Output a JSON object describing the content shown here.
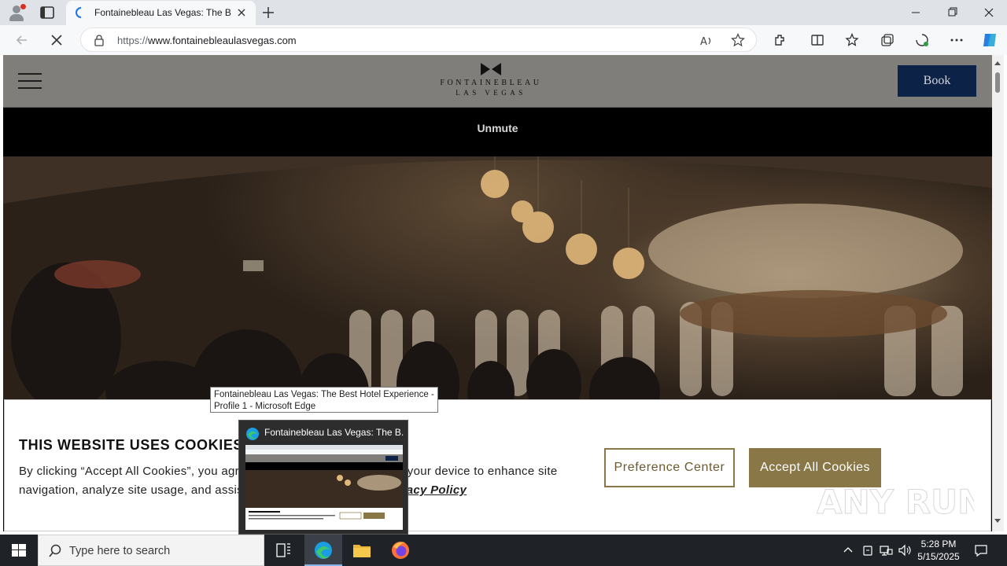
{
  "browser": {
    "tab_title": "Fontainebleau Las Vegas: The Best Hotel Experience",
    "url_prefix": "https://",
    "url_host": "www.fontainebleaulasvegas.com"
  },
  "site": {
    "logo_name": "FONTAINEBLEAU",
    "logo_city": "LAS VEGAS",
    "book_label": "Book",
    "unmute_label": "Unmute"
  },
  "cookie_banner": {
    "heading": "THIS WEBSITE USES COOKIES",
    "body_text": "By clicking “Accept All Cookies”, you agree to the storing of cookies on your device to enhance site navigation, analyze site usage, and assist in our marketing efforts.",
    "policy_link": "Privacy Policy",
    "preference_button": "Preference Center",
    "accept_button": "Accept All Cookies"
  },
  "overlays": {
    "tooltip_text": "Fontainebleau Las Vegas: The Best Hotel Experience - Profile 1 - Microsoft Edge",
    "thumbnail_title": "Fontainebleau Las Vegas: The B..."
  },
  "watermark": "ANY RUN",
  "taskbar": {
    "search_placeholder": "Type here to search",
    "time": "5:28 PM",
    "date": "5/15/2025"
  },
  "colors": {
    "book_button": "#0d2247",
    "cookie_accent": "#8a7748",
    "header_gray": "#807e7b"
  }
}
